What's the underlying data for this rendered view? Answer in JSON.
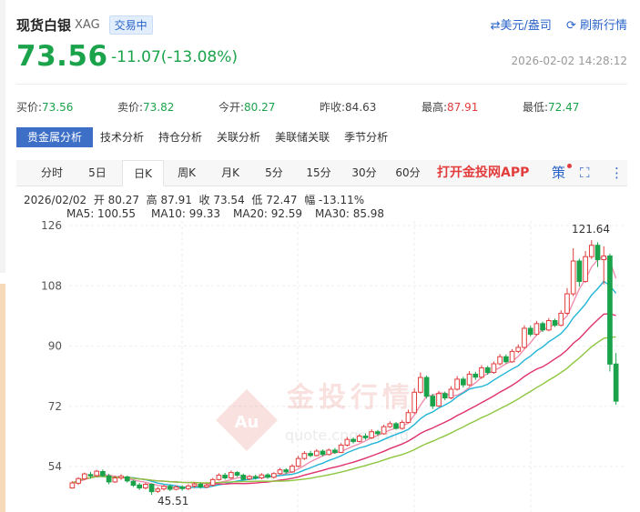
{
  "header": {
    "name": "现货白银",
    "code": "XAG",
    "status": "交易中"
  },
  "actions": {
    "currency": "⇄美元/盎司",
    "refresh": "刷新行情"
  },
  "price": {
    "last": "73.56",
    "change": "-11.07(-13.08%)",
    "time": "2026-02-02 14:28:12"
  },
  "quotes": [
    {
      "label": "买价:",
      "value": "73.56",
      "color": "green"
    },
    {
      "label": "卖价:",
      "value": "73.82",
      "color": "green"
    },
    {
      "label": "今开:",
      "value": "80.27",
      "color": "green"
    },
    {
      "label": "昨收:",
      "value": "84.63",
      "color": "plain"
    },
    {
      "label": "最高:",
      "value": "87.91",
      "color": "red"
    },
    {
      "label": "最低:",
      "value": "72.47",
      "color": "green"
    }
  ],
  "tabs": [
    "贵金属分析",
    "技术分析",
    "持仓分析",
    "关联分析",
    "美联储关联",
    "季节分析"
  ],
  "periods": [
    "分时",
    "5日",
    "日K",
    "周K",
    "月K",
    "5分",
    "15分",
    "30分",
    "60分"
  ],
  "active_period": "日K",
  "app_promo": "打开金投网APP",
  "toolbar": {
    "strategy_label": "策",
    "fullscreen_icon": "fullscreen-icon",
    "more_icon": "more-vertical-icon"
  },
  "ohlc": {
    "date": "2026/02/02",
    "open_label": "开",
    "open": "80.27",
    "high_label": "高",
    "high": "87.91",
    "close_label": "收",
    "close": "73.54",
    "low_label": "低",
    "low": "72.47",
    "range_label": "幅",
    "range": "-13.11%"
  },
  "ma_legend": [
    {
      "label": "MA5: 100.55",
      "color": "#f08fb0"
    },
    {
      "label": "MA10: 99.33",
      "color": "#22b5d6"
    },
    {
      "label": "MA20: 92.59",
      "color": "#e0306e"
    },
    {
      "label": "MA30: 85.98",
      "color": "#8dc63f"
    }
  ],
  "watermark": {
    "brand": "金投行情",
    "logo": "Au",
    "url": "quote.cngold.org"
  },
  "colors": {
    "up": "#e23c3c",
    "down": "#1aa34a",
    "accent": "#2a63c9"
  },
  "chart_data": {
    "type": "candlestick",
    "y_ticks": [
      126,
      108,
      90,
      72,
      54
    ],
    "ylim": [
      45,
      127
    ],
    "annotations": {
      "max": "121.64",
      "min": "45.51"
    },
    "candles": [
      [
        47.6,
        49.1,
        47.4,
        49.6
      ],
      [
        49,
        50.4,
        48.5,
        50.8
      ],
      [
        50.3,
        51.8,
        50,
        52.2
      ],
      [
        51.6,
        51.2,
        50.4,
        52.4
      ],
      [
        51.3,
        52.6,
        50.9,
        53
      ],
      [
        52.5,
        51.3,
        50.9,
        53.1
      ],
      [
        51.2,
        49.4,
        48.7,
        51.8
      ],
      [
        49.4,
        50.6,
        49.1,
        51.2
      ],
      [
        50.6,
        51.1,
        50,
        51.7
      ],
      [
        50.9,
        49.7,
        49.2,
        51.3
      ],
      [
        49.6,
        48.4,
        47.9,
        50.1
      ],
      [
        48.5,
        47.6,
        47,
        49.1
      ],
      [
        47.6,
        48.7,
        47.2,
        49.1
      ],
      [
        48.7,
        46.5,
        45.51,
        49
      ],
      [
        46.6,
        47.3,
        46.1,
        47.9
      ],
      [
        47.3,
        48.1,
        46.8,
        48.6
      ],
      [
        48.1,
        47.2,
        46.7,
        48.6
      ],
      [
        47.2,
        47.9,
        46.9,
        48.4
      ],
      [
        47.9,
        47.4,
        46.8,
        48.4
      ],
      [
        47.4,
        48.2,
        46.9,
        48.7
      ],
      [
        48.2,
        48.8,
        47.6,
        49.3
      ],
      [
        48.7,
        47.9,
        47.4,
        49.2
      ],
      [
        47.9,
        48.4,
        47.5,
        48.9
      ],
      [
        48.4,
        50.1,
        48.1,
        50.6
      ],
      [
        50.1,
        51.4,
        49.8,
        52
      ],
      [
        51.4,
        50.6,
        50.1,
        52.1
      ],
      [
        50.6,
        52.2,
        50.3,
        52.8
      ],
      [
        52.2,
        51.4,
        50.9,
        52.6
      ],
      [
        51.4,
        50.2,
        49.8,
        51.9
      ],
      [
        50.3,
        51,
        49.9,
        51.5
      ],
      [
        51,
        50.6,
        50.1,
        51.6
      ],
      [
        50.6,
        51.5,
        50.2,
        52
      ],
      [
        51.5,
        50.8,
        50.3,
        52
      ],
      [
        50.8,
        51.9,
        50.4,
        52.3
      ],
      [
        51.9,
        53,
        51.6,
        53.6
      ],
      [
        53,
        52.4,
        51.8,
        53.5
      ],
      [
        52.4,
        54.1,
        52.1,
        54.7
      ],
      [
        54.1,
        56.4,
        53.8,
        57.2
      ],
      [
        56.4,
        57.9,
        56,
        58.6
      ],
      [
        57.9,
        57.3,
        56.8,
        58.7
      ],
      [
        57.3,
        58.6,
        57,
        59.2
      ],
      [
        58.6,
        57.6,
        57.1,
        59.1
      ],
      [
        57.6,
        58.9,
        57.3,
        59.4
      ],
      [
        58.9,
        58.2,
        57.8,
        59.5
      ],
      [
        58.2,
        60.4,
        58,
        61
      ],
      [
        60.4,
        62.1,
        60,
        62.8
      ],
      [
        62.1,
        61.5,
        60.9,
        62.7
      ],
      [
        61.5,
        63.1,
        61.2,
        63.7
      ],
      [
        63.1,
        62.6,
        62,
        63.9
      ],
      [
        62.6,
        64.4,
        62.2,
        65.1
      ],
      [
        64.4,
        63.8,
        63.2,
        64.9
      ],
      [
        63.8,
        65.9,
        63.5,
        66.5
      ],
      [
        65.9,
        66.8,
        65.5,
        67.5
      ],
      [
        66.8,
        65.4,
        65,
        67.3
      ],
      [
        65.4,
        67.2,
        65,
        67.9
      ],
      [
        67.2,
        70.1,
        66.9,
        71
      ],
      [
        70.1,
        76.2,
        69.8,
        77.4
      ],
      [
        76.2,
        80.6,
        75.8,
        82.1
      ],
      [
        80.6,
        75,
        74.3,
        81.2
      ],
      [
        75,
        72.1,
        71.2,
        75.7
      ],
      [
        72.1,
        75.8,
        71.8,
        76.6
      ],
      [
        75.8,
        74.5,
        73.8,
        76.4
      ],
      [
        74.5,
        77.1,
        74.1,
        78
      ],
      [
        77.1,
        80.1,
        76.7,
        81
      ],
      [
        80.1,
        78.4,
        77.6,
        80.8
      ],
      [
        78.4,
        81.6,
        78,
        82.5
      ],
      [
        81.6,
        80.7,
        79.9,
        82.3
      ],
      [
        80.7,
        83.5,
        80.2,
        84.3
      ],
      [
        83.5,
        82.1,
        81.4,
        84.1
      ],
      [
        82.1,
        84.7,
        81.7,
        85.4
      ],
      [
        84.7,
        86.8,
        84.2,
        87.6
      ],
      [
        86.8,
        85.3,
        84.8,
        87.5
      ],
      [
        85.3,
        88.4,
        85,
        89.1
      ],
      [
        88.4,
        89.6,
        87.9,
        90.5
      ],
      [
        89.6,
        95.3,
        89.2,
        96.2
      ],
      [
        95.3,
        93.5,
        92.9,
        96.1
      ],
      [
        93.5,
        96.7,
        93.1,
        97.5
      ],
      [
        96.7,
        94.8,
        94.2,
        97.3
      ],
      [
        94.8,
        97.6,
        94.4,
        98.4
      ],
      [
        97.6,
        96.2,
        95.7,
        98.2
      ],
      [
        96.2,
        99.8,
        95.9,
        100.7
      ],
      [
        99.8,
        105.6,
        99.4,
        107.3
      ],
      [
        105.6,
        115.4,
        104.9,
        119.2
      ],
      [
        115.4,
        109.3,
        107.8,
        116.1
      ],
      [
        109.3,
        116.7,
        108.9,
        118.4
      ],
      [
        116.7,
        120.1,
        116,
        121.64
      ],
      [
        120.1,
        115.8,
        113.6,
        121
      ],
      [
        115.8,
        116.9,
        108.4,
        119.8
      ],
      [
        116.9,
        84.6,
        82.4,
        117.6
      ],
      [
        84.63,
        73.54,
        72.47,
        87.91
      ]
    ],
    "ma5": [
      49,
      49.5,
      50.1,
      50.7,
      51.3,
      51.6,
      51.4,
      51.1,
      50.8,
      50.4,
      50,
      49.6,
      49.3,
      48.8,
      48.4,
      48.1,
      47.9,
      47.6,
      47.5,
      47.6,
      48,
      48.1,
      48.2,
      48.6,
      49.2,
      49.6,
      50.1,
      50.6,
      50.9,
      51,
      50.9,
      50.8,
      50.9,
      51.1,
      51.4,
      51.9,
      52.4,
      53.3,
      54.3,
      55.4,
      56.3,
      57.2,
      57.8,
      58.1,
      58.5,
      59.3,
      60.1,
      60.8,
      61.7,
      62.6,
      63.3,
      64.1,
      64.9,
      65.5,
      66.1,
      67,
      69.4,
      72.4,
      75,
      75.3,
      76,
      75.9,
      75,
      75.3,
      76.2,
      77.7,
      79,
      80.7,
      81.8,
      82.6,
      83.6,
      84.7,
      85.5,
      86.9,
      89.1,
      91,
      93.3,
      94.9,
      95.6,
      96.4,
      97.2,
      99,
      103.1,
      107.1,
      110,
      113.6,
      115.8,
      116.9,
      115.4,
      110.2
    ]
  }
}
